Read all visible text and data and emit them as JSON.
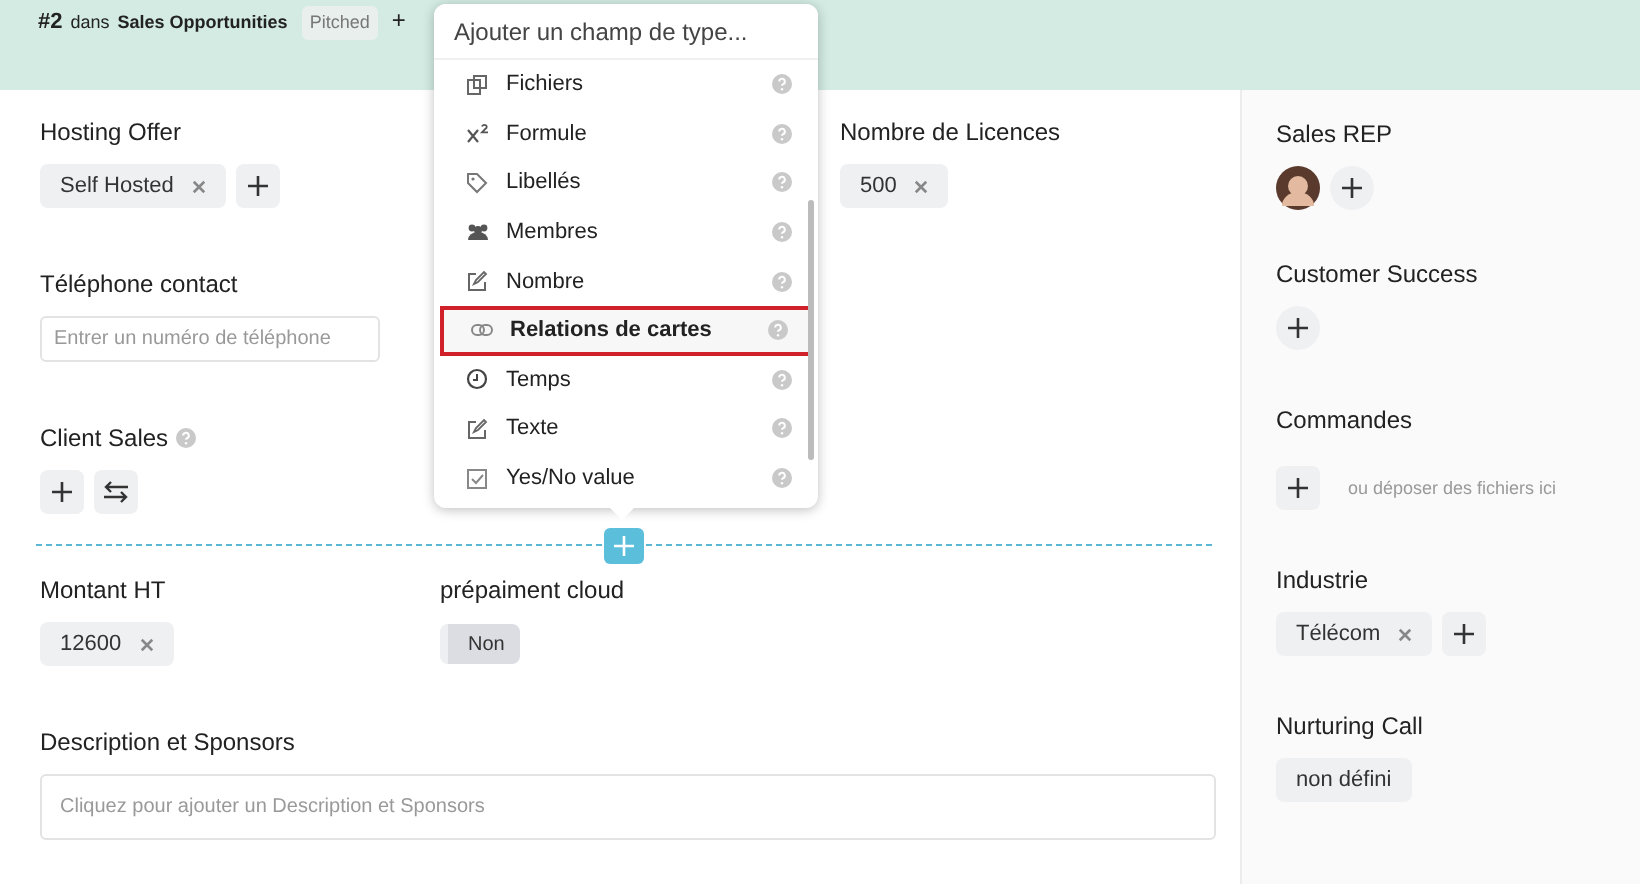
{
  "header": {
    "number": "#2",
    "preposition": "dans",
    "board": "Sales Opportunities",
    "status": "Pitched",
    "add": "+"
  },
  "fields": {
    "hosting": {
      "label": "Hosting Offer",
      "tags": [
        "Self Hosted"
      ]
    },
    "licences": {
      "label": "Nombre de Licences",
      "tags": [
        "500"
      ]
    },
    "phone": {
      "label": "Téléphone contact",
      "placeholder": "Entrer un numéro de téléphone"
    },
    "client_sales": {
      "label": "Client Sales"
    },
    "amount": {
      "label": "Montant HT",
      "tags": [
        "12600"
      ]
    },
    "prepaid": {
      "label": "prépaiment cloud",
      "value": "Non",
      "on": false
    },
    "description": {
      "label": "Description et Sponsors",
      "placeholder": "Cliquez pour ajouter un Description et Sponsors"
    }
  },
  "sidebar": {
    "sales_rep": {
      "label": "Sales REP"
    },
    "customer_success": {
      "label": "Customer Success"
    },
    "orders": {
      "label": "Commandes",
      "drop_hint": "ou déposer des fichiers ici"
    },
    "industry": {
      "label": "Industrie",
      "tags": [
        "Télécom"
      ]
    },
    "nurturing": {
      "label": "Nurturing Call",
      "value": "non défini"
    }
  },
  "field_menu": {
    "placeholder": "Ajouter un champ de type...",
    "items": [
      {
        "kind": "files",
        "label": "Fichiers",
        "selected": false
      },
      {
        "kind": "formula",
        "label": "Formule",
        "selected": false
      },
      {
        "kind": "labels",
        "label": "Libellés",
        "selected": false
      },
      {
        "kind": "members",
        "label": "Membres",
        "selected": false
      },
      {
        "kind": "number",
        "label": "Nombre",
        "selected": false
      },
      {
        "kind": "relation",
        "label": "Relations de cartes",
        "selected": true
      },
      {
        "kind": "time",
        "label": "Temps",
        "selected": false
      },
      {
        "kind": "text",
        "label": "Texte",
        "selected": false
      },
      {
        "kind": "boolean",
        "label": "Yes/No value",
        "selected": false
      }
    ]
  }
}
